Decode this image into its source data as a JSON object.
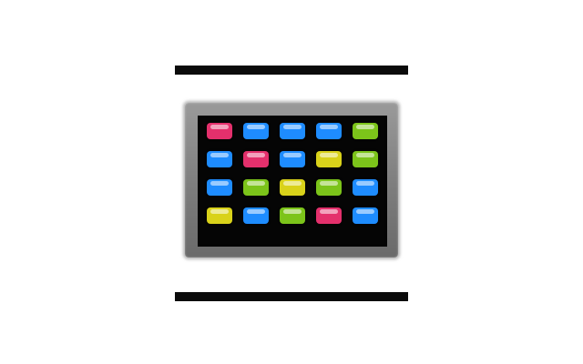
{
  "icon": {
    "name": "app-launcher-grid-icon",
    "tile_colors": {
      "pink": "#e4306c",
      "blue": "#1e8cff",
      "yellow": "#d9d21a",
      "green": "#7cc41a"
    },
    "rows": [
      [
        "pink",
        "blue",
        "blue",
        "blue",
        "green"
      ],
      [
        "blue",
        "pink",
        "blue",
        "yellow",
        "green"
      ],
      [
        "blue",
        "green",
        "yellow",
        "green",
        "blue"
      ],
      [
        "yellow",
        "blue",
        "green",
        "pink",
        "blue"
      ]
    ]
  }
}
